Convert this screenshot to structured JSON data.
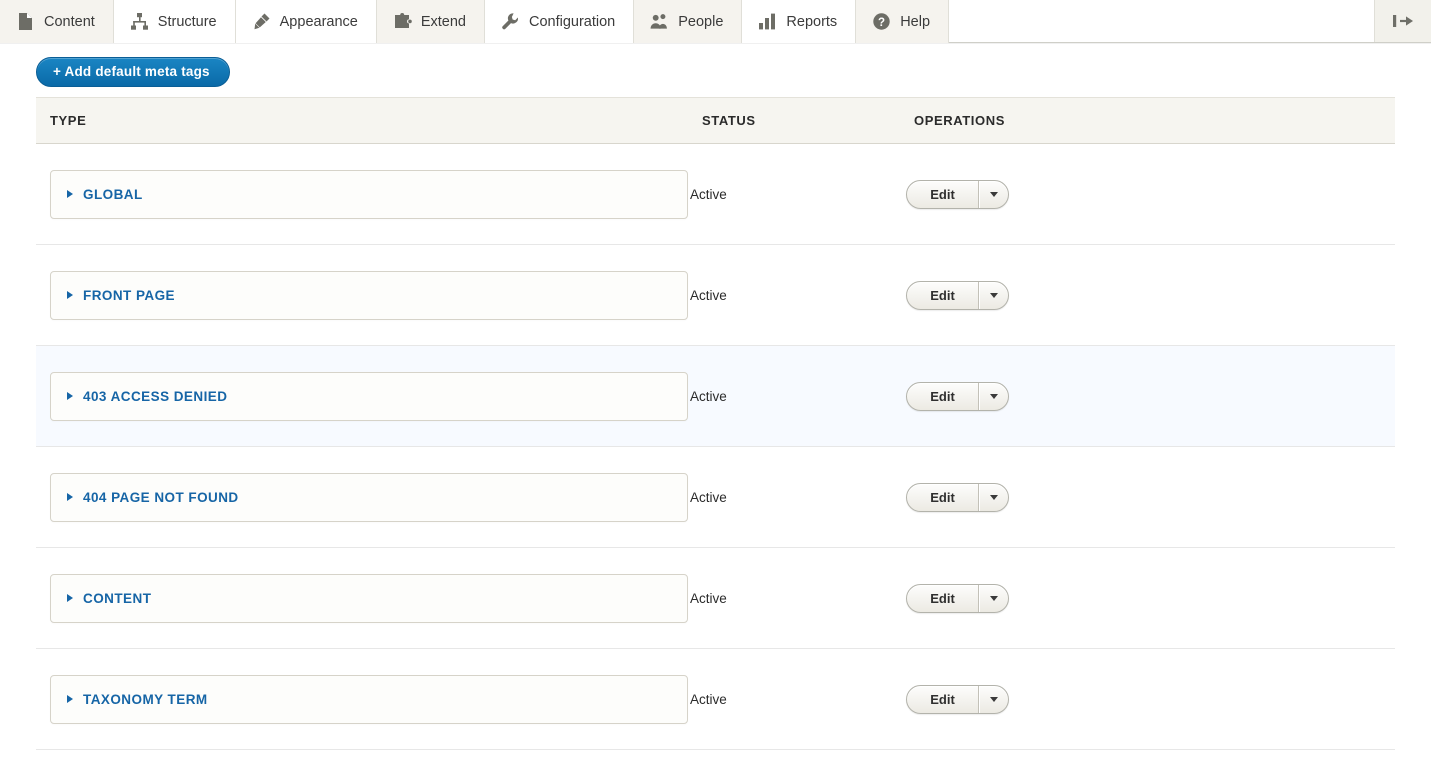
{
  "toolbar": {
    "tabs": [
      {
        "label": "Content",
        "icon": "file-icon",
        "active": true
      },
      {
        "label": "Structure",
        "icon": "sitemap-icon",
        "active": false
      },
      {
        "label": "Appearance",
        "icon": "paintbrush-icon",
        "active": false
      },
      {
        "label": "Extend",
        "icon": "puzzle-piece-icon",
        "active": false
      },
      {
        "label": "Configuration",
        "icon": "wrench-icon",
        "active": false
      },
      {
        "label": "People",
        "icon": "people-icon",
        "active": false
      },
      {
        "label": "Reports",
        "icon": "bar-chart-icon",
        "active": false
      },
      {
        "label": "Help",
        "icon": "question-mark-icon",
        "active": false
      }
    ],
    "toggle_icon": "toolbar-orientation-toggle-icon"
  },
  "actions": {
    "add_label": "+ Add default meta tags"
  },
  "table": {
    "headers": {
      "type": "TYPE",
      "status": "STATUS",
      "operations": "OPERATIONS"
    },
    "rows": [
      {
        "type": "GLOBAL",
        "status": "Active",
        "op_label": "Edit",
        "highlight": false
      },
      {
        "type": "FRONT PAGE",
        "status": "Active",
        "op_label": "Edit",
        "highlight": false
      },
      {
        "type": "403 ACCESS DENIED",
        "status": "Active",
        "op_label": "Edit",
        "highlight": true
      },
      {
        "type": "404 PAGE NOT FOUND",
        "status": "Active",
        "op_label": "Edit",
        "highlight": false
      },
      {
        "type": "CONTENT",
        "status": "Active",
        "op_label": "Edit",
        "highlight": false
      },
      {
        "type": "TAXONOMY TERM",
        "status": "Active",
        "op_label": "Edit",
        "highlight": false
      }
    ]
  },
  "colors": {
    "accent_blue": "#1665a6",
    "button_blue": "#0e77b8",
    "toolbar_bg": "#f2f1eb",
    "header_bg": "#f6f5f0",
    "row_highlight": "#f7faff"
  }
}
